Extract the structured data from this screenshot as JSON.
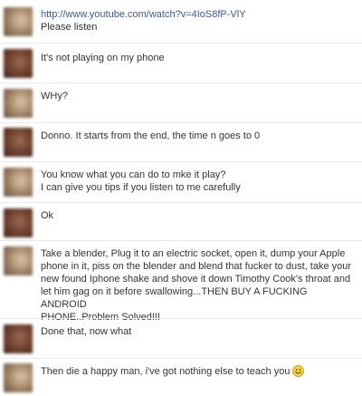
{
  "messages": [
    {
      "avatar": "light",
      "link": "http://www.youtube.com/watch?v=4IoS8fP-VlY",
      "lines": [
        "Please listen"
      ]
    },
    {
      "avatar": "dark",
      "lines": [
        "It's not playing on my phone"
      ]
    },
    {
      "avatar": "light",
      "lines": [
        "WHy?"
      ]
    },
    {
      "avatar": "dark",
      "lines": [
        "Donno. It starts from the end, the time n goes to 0"
      ]
    },
    {
      "avatar": "light",
      "lines": [
        "You know what you can do to mke it play?",
        "I can give you tips if you listen to me carefully"
      ]
    },
    {
      "avatar": "dark",
      "lines": [
        "Ok"
      ]
    },
    {
      "avatar": "light",
      "lines": [
        "Take a blender, Plug it to an electric socket, open it, dump your Apple",
        "phone in it, piss on the blender and blend that fucker to dust, take your",
        "new found Iphone shake and shove it down Timothy Cook's throat and",
        "let him gag on it before swallowing...THEN BUY A FUCKING ANDROID",
        "PHONE..Problem Solved!!!"
      ]
    },
    {
      "avatar": "dark",
      "lines": [
        "Done that, now what"
      ]
    },
    {
      "avatar": "light",
      "lines": [
        "Then die a happy man, i've got nothing else to teach you"
      ],
      "emoticon": "smiley-face-icon"
    }
  ]
}
